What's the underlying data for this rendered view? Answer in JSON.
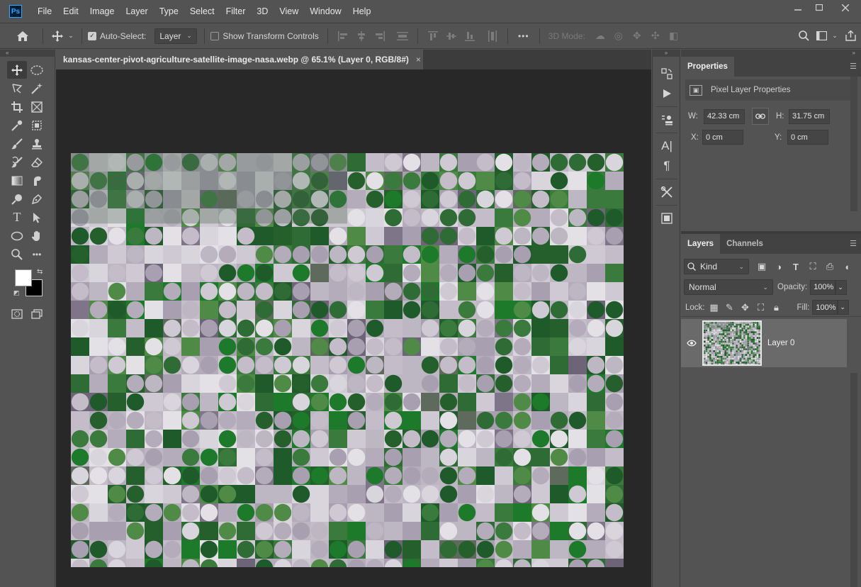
{
  "app": {
    "logo": "Ps",
    "menu": [
      "File",
      "Edit",
      "Image",
      "Layer",
      "Type",
      "Select",
      "Filter",
      "3D",
      "View",
      "Window",
      "Help"
    ]
  },
  "options_bar": {
    "auto_select_label": "Auto-Select:",
    "auto_select_checked": true,
    "auto_select_target": "Layer",
    "show_transform_label": "Show Transform Controls",
    "show_transform_checked": false,
    "mode3d_label": "3D Mode:",
    "more_label": "•••"
  },
  "document": {
    "tab_title": "kansas-center-pivot-agriculture-satellite-image-nasa.webp @ 65.1% (Layer 0, RGB/8#)",
    "close_label": "×"
  },
  "colors": {
    "foreground": "#ffffff",
    "background": "#000000",
    "accent": "#31a8ff"
  },
  "properties_panel": {
    "tab_label": "Properties",
    "section_label": "Pixel Layer Properties",
    "w_label": "W:",
    "w_value": "42.33 cm",
    "h_label": "H:",
    "h_value": "31.75 cm",
    "x_label": "X:",
    "x_value": "0 cm",
    "y_label": "Y:",
    "y_value": "0 cm"
  },
  "layers_panel": {
    "tabs": [
      "Layers",
      "Channels"
    ],
    "kind_label": "Kind",
    "blend_mode": "Normal",
    "opacity_label": "Opacity:",
    "opacity_value": "100%",
    "lock_label": "Lock:",
    "fill_label": "Fill:",
    "fill_value": "100%",
    "layers": [
      {
        "name": "Layer 0",
        "visible": true,
        "selected": true
      }
    ]
  },
  "icons": {
    "toolbar": [
      "move-icon",
      "marquee-ellipse-icon",
      "lasso-icon",
      "magic-wand-icon",
      "crop-icon",
      "frame-icon",
      "eyedropper-icon",
      "patch-icon",
      "brush-icon",
      "stamp-icon",
      "history-brush-icon",
      "eraser-icon",
      "gradient-icon",
      "smudge-icon",
      "dodge-icon",
      "pen-icon",
      "type-icon",
      "path-select-icon",
      "ellipse-shape-icon",
      "hand-icon",
      "zoom-icon",
      "more-tools-icon"
    ]
  }
}
